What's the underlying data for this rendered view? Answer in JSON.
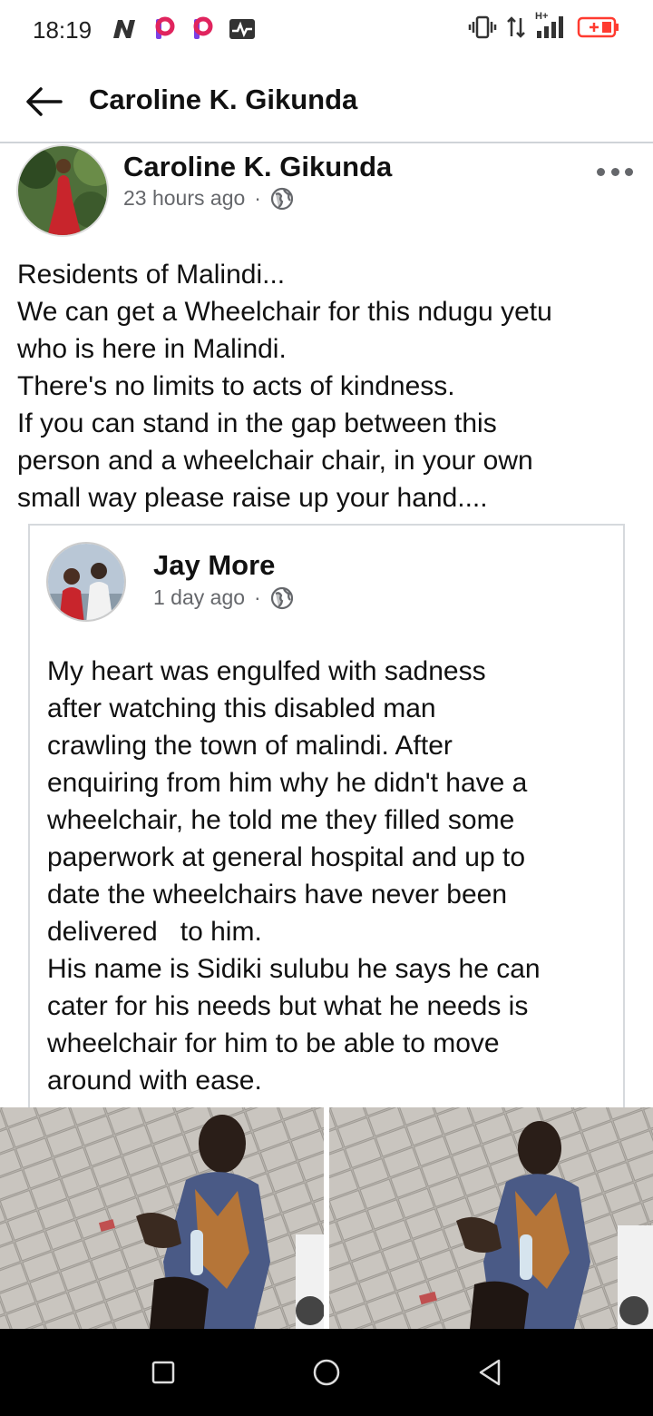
{
  "status_bar": {
    "time": "18:19",
    "left_icons": [
      "n-app-icon",
      "p-app-icon",
      "p-app-icon",
      "activity-icon"
    ],
    "right_icons": [
      "vibrate-icon",
      "data-arrows-icon",
      "signal-icon",
      "battery-icon"
    ],
    "network_label": "H+"
  },
  "header": {
    "title": "Caroline K. Gikunda",
    "back_icon": "arrow-left-icon"
  },
  "post": {
    "author": "Caroline K. Gikunda",
    "time": "23 hours ago",
    "separator": "·",
    "privacy_icon": "globe-icon",
    "text_lines": [
      "Residents of Malindi...",
      "We can get a Wheelchair for this ndugu yetu",
      "who is here in Malindi.",
      "There's no limits to acts of kindness.",
      "If you can stand in the gap between this",
      "person and a wheelchair chair, in your own",
      "small way please raise up your hand...."
    ]
  },
  "shared_post": {
    "author": "Jay More",
    "time": "1 day ago",
    "separator": "·",
    "privacy_icon": "globe-icon",
    "text_lines": [
      "My heart was engulfed with sadness",
      "after watching this disabled man",
      "crawling the town of malindi. After",
      "enquiring from him why he didn't have a",
      "wheelchair, he told me they filled some",
      "paperwork at general hospital and up to",
      "date the wheelchairs have never been",
      "delivered   to him.",
      "His name is Sidiki sulubu he says he can",
      "cater for his needs but what he needs is",
      "wheelchair for him to be able to move",
      "around with ease."
    ]
  },
  "nav_bar": {
    "buttons": [
      "square-recents-icon",
      "circle-home-icon",
      "triangle-back-icon"
    ]
  },
  "colors": {
    "text_primary": "#050505",
    "text_secondary": "#65676b",
    "divider": "#cfd3d8",
    "nav_background": "#000000",
    "app_icon_accent": "#e0245e",
    "battery_accent": "#ff3b30"
  }
}
